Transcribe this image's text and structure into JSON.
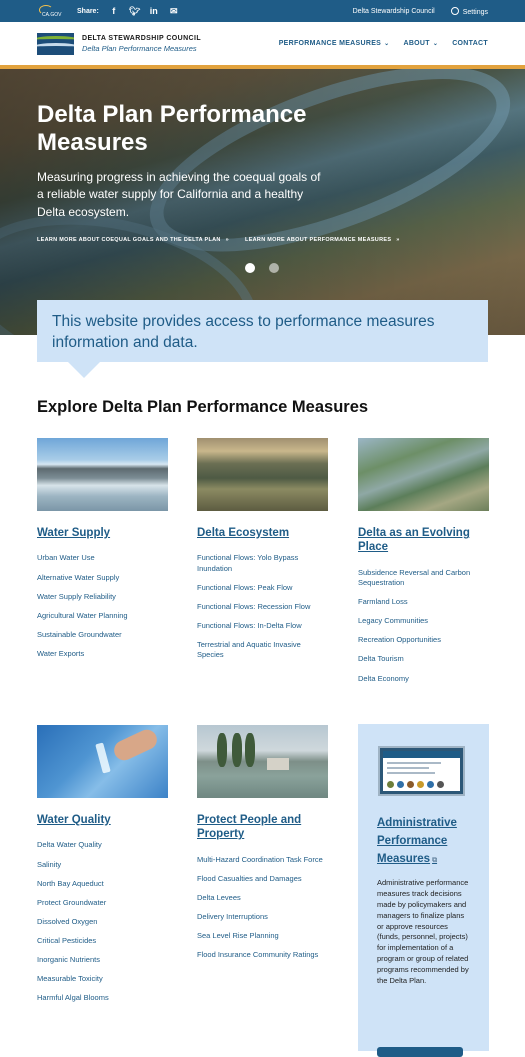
{
  "utility_bar": {
    "logo_text": "CA.GOV",
    "share_label": "Share:",
    "social_icons": [
      "f",
      "t",
      "in",
      "✉"
    ],
    "council_link": "Delta Stewardship Council",
    "settings_label": "Settings"
  },
  "header": {
    "org_name": "DELTA STEWARDSHIP COUNCIL",
    "site_name": "Delta Plan Performance Measures",
    "nav": [
      "PERFORMANCE MEASURES",
      "ABOUT",
      "CONTACT"
    ],
    "accent_color": "#e2a23d"
  },
  "hero": {
    "title": "Delta Plan Performance Measures",
    "subtitle": "Measuring progress in achieving the coequal goals of a reliable water supply for California and a healthy Delta ecosystem.",
    "link1": "LEARN MORE ABOUT COEQUAL GOALS AND THE DELTA PLAN",
    "link2": "LEARN MORE ABOUT PERFORMANCE MEASURES",
    "slide_count": 2,
    "active_slide": 1
  },
  "callout": {
    "text": "This website provides access to performance measures information and data."
  },
  "section_title": "Explore Delta Plan Performance Measures",
  "cards": [
    {
      "title": "Water Supply",
      "links": [
        "Urban Water Use",
        "Alternative Water Supply",
        "Water Supply Reliability",
        "Agricultural Water Planning",
        "Sustainable Groundwater",
        "Water Exports"
      ]
    },
    {
      "title": "Delta Ecosystem",
      "links": [
        "Functional Flows: Yolo Bypass Inundation",
        "Functional Flows: Peak Flow",
        "Functional Flows: Recession Flow",
        "Functional Flows: In-Delta Flow",
        "Terrestrial and Aquatic Invasive Species"
      ]
    },
    {
      "title": "Delta as an Evolving Place",
      "links": [
        "Subsidence Reversal and Carbon Sequestration",
        "Farmland Loss",
        "Legacy Communities",
        "Recreation Opportunities",
        "Delta Tourism",
        "Delta Economy"
      ]
    },
    {
      "title": "Water Quality",
      "links": [
        "Delta Water Quality",
        "Salinity",
        "North Bay Aqueduct",
        "Protect Groundwater",
        "Dissolved Oxygen",
        "Critical Pesticides",
        "Inorganic Nutrients",
        "Measurable Toxicity",
        "Harmful Algal Blooms"
      ]
    },
    {
      "title": "Protect People and Property",
      "links": [
        "Multi-Hazard Coordination Task Force",
        "Flood Casualties and Damages",
        "Delta Levees",
        "Delivery Interruptions",
        "Sea Level Rise Planning",
        "Flood Insurance Community Ratings"
      ]
    }
  ],
  "admin": {
    "title": "Administrative Performance Measures",
    "description": "Administrative performance measures track decisions made by policymakers and managers to finalize plans or approve resources (funds, personnel, projects) for implementation of a program or group of related programs recommended by the Delta Plan."
  }
}
